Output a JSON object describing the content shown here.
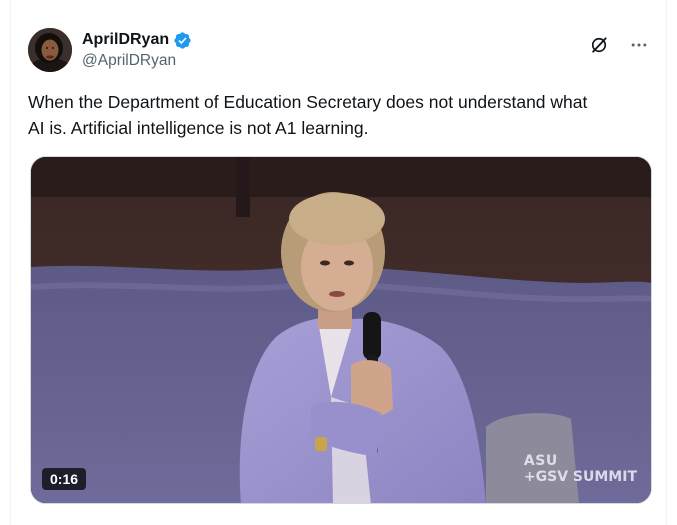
{
  "author": {
    "display_name": "AprilDRyan",
    "handle": "@AprilDRyan",
    "verified": true,
    "verified_color": "#1d9bf0"
  },
  "tweet": {
    "text_line1": "When the Department of Education Secretary does not understand what",
    "text_line2": "AI is. Artificial intelligence is not A1 learning."
  },
  "media": {
    "duration": "0:16",
    "watermark_line1": "ASU",
    "watermark_line2": "+GSV SUMMIT"
  },
  "icons": {
    "grok": "grok-icon",
    "more": "more-icon",
    "verified": "verified-badge-icon"
  }
}
